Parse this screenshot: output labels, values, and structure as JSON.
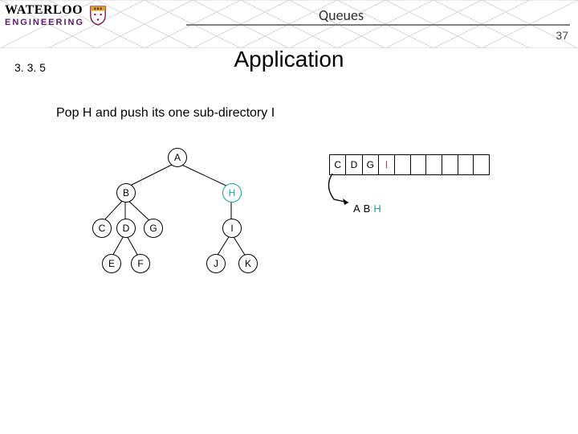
{
  "header": {
    "logo_top": "WATERLOO",
    "logo_bottom": "ENGINEERING",
    "course_topic": "Queues",
    "page_number": "37"
  },
  "section_number": "3. 3. 5",
  "slide_title": "Application",
  "body_text": "Pop H and push its one sub-directory I",
  "tree": {
    "A": "A",
    "B": "B",
    "C": "C",
    "D": "D",
    "E": "E",
    "F": "F",
    "G": "G",
    "H": "H",
    "I": "I",
    "J": "J",
    "K": "K"
  },
  "queue_cells": [
    "C",
    "D",
    "G",
    "I",
    "",
    "",
    "",
    "",
    "",
    ""
  ],
  "queue_red_indices": [
    3
  ],
  "visited": [
    {
      "t": "A",
      "cls": ""
    },
    {
      "t": "B",
      "cls": ""
    },
    {
      "t": "H",
      "cls": "teal"
    }
  ]
}
